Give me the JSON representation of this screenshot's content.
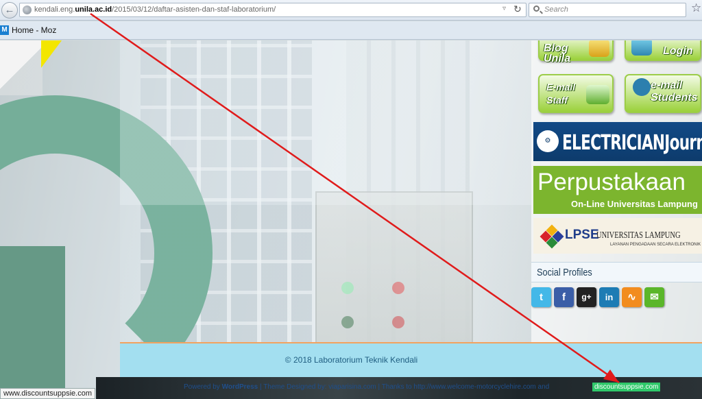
{
  "browser": {
    "url_host_prefix": "kendali.eng.",
    "url_host_bold": "unila.ac.id",
    "url_path": "/2015/03/12/daftar-asisten-dan-staf-laboratorium/",
    "search_placeholder": "Search",
    "bookmark_label": "Home - Moz",
    "bookmark_icon_letter": "M"
  },
  "sidebar": {
    "blog_label": "Blog Unila",
    "login_label": "Login",
    "email_staff_label": "E-mail Staff",
    "email_students_label": "e-mail Students",
    "electrician_label": "ELECTRICIANJournal",
    "perpustakaan_title": "Perpustakaan",
    "perpustakaan_sub": "On-Line Universitas Lampung",
    "lpse_label": "LPSE",
    "lpse_univ": "UNIVERSITAS LAMPUNG",
    "lpse_tagline": "LAYANAN PENGADAAN SECARA ELEKTRONIK",
    "social_title": "Social Profiles",
    "social_icons": [
      "twitter-icon",
      "facebook-icon",
      "googleplus-icon",
      "linkedin-icon",
      "rss-icon",
      "email-icon"
    ]
  },
  "footer": {
    "copyright": "© 2018 Laboratorium Teknik Kendali",
    "credits_powered": "Powered by",
    "credits_wp": "WordPress",
    "credits_rest": "| Theme Designed by: viaparisina.com | Thanks to http://www.welcome-motorcyclehire.com and"
  },
  "status": {
    "hover_url": "www.discountsuppsie.com",
    "hover_badge": "discountsuppsie.com"
  },
  "colors": {
    "annotation_arrow": "#e01b1b",
    "footer_bar": "#a3dff0",
    "button_green": "#9bd13b"
  }
}
